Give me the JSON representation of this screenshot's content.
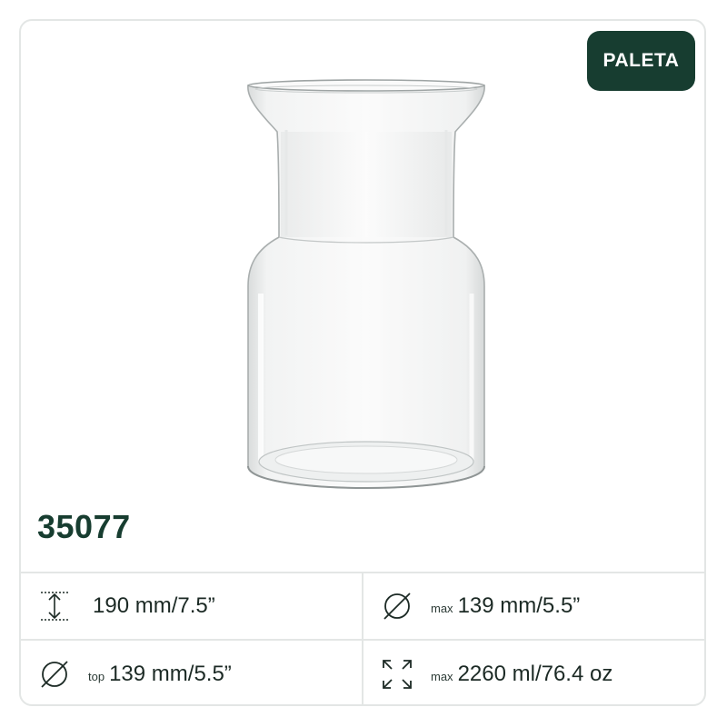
{
  "badge": {
    "label": "PALETA"
  },
  "product": {
    "code": "35077"
  },
  "specs": [
    {
      "icon": "height-icon",
      "prefix": "",
      "value": "190 mm/7.5”"
    },
    {
      "icon": "diameter-icon",
      "prefix": "max",
      "value": "139 mm/5.5”"
    },
    {
      "icon": "diameter-icon",
      "prefix": "top",
      "value": "139 mm/5.5”"
    },
    {
      "icon": "expand-arrows-icon",
      "prefix": "max",
      "value": "2260 ml/76.4 oz"
    }
  ],
  "colors": {
    "brand": "#173d30",
    "border": "#e3e6e5",
    "text": "#1c2a25"
  }
}
